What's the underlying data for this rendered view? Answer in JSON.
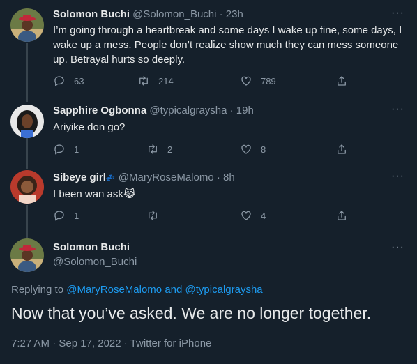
{
  "tweets": [
    {
      "name": "Solomon Buchi",
      "handle": "@Solomon_Buchi",
      "time": "· 23h",
      "text": "I’m going through a heartbreak and some days I wake up fine, some days, I wake up a mess. People don’t realize show much they can mess someone up. Betrayal hurts so deeply.",
      "replies": "63",
      "retweets": "214",
      "likes": "789"
    },
    {
      "name": "Sapphire Ogbonna",
      "handle": "@typicalgraysha",
      "time": "· 19h",
      "text": "Ariyike don go?",
      "replies": "1",
      "retweets": "2",
      "likes": "8"
    },
    {
      "name": "Sibeye girl",
      "name_suffix": "💤",
      "handle": "@MaryRoseMalomo",
      "time": "· 8h",
      "text": "I been wan ask😹",
      "replies": "1",
      "retweets": "",
      "likes": "4"
    }
  ],
  "focused": {
    "name": "Solomon Buchi",
    "handle": "@Solomon_Buchi",
    "replying_prefix": "Replying to",
    "replying_user1": "@MaryRoseMalomo",
    "replying_and": "and",
    "replying_user2": "@typicalgraysha",
    "text": "Now that you’ve asked. We are no longer together.",
    "meta": "7:27 AM · Sep 17, 2022 · Twitter for iPhone"
  },
  "more_label": "···",
  "colors": {
    "background": "#15202b",
    "text": "#e7e9ea",
    "secondary": "#8b98a5",
    "link": "#1d9bf0"
  }
}
